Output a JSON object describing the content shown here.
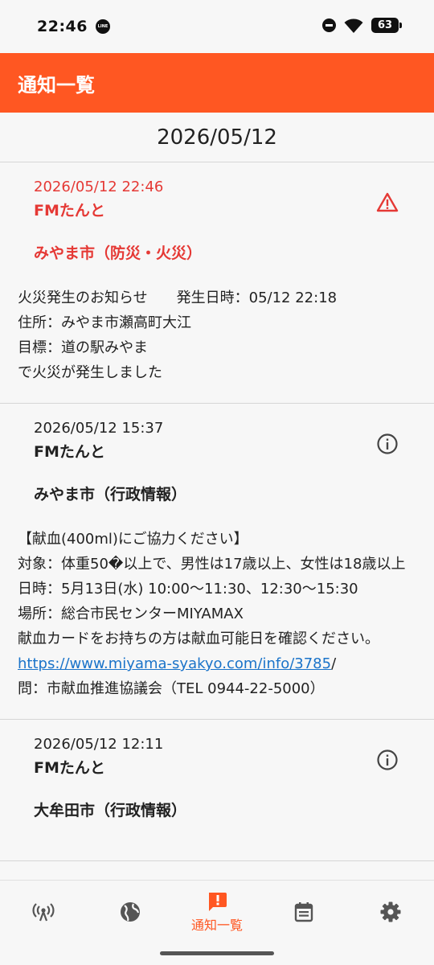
{
  "status_bar": {
    "time": "22:46",
    "line_badge": "LINE",
    "battery": "63"
  },
  "app_bar": {
    "title": "通知一覧"
  },
  "date_header": "2026/05/12",
  "notifications": [
    {
      "type": "alert",
      "icon": "warning-icon",
      "time": "2026/05/12 22:46",
      "source": "FMたんと",
      "category": "みやま市（防災・火災）",
      "body": "火災発生のお知らせ　　発生日時：05/12 22:18\n住所：みやま市瀬高町大江\n目標：道の駅みやま\nで火災が発生しました"
    },
    {
      "type": "info",
      "icon": "info-icon",
      "time": "2026/05/12 15:37",
      "source": "FMたんと",
      "category": "みやま市（行政情報）",
      "body": "【献血(400ml)にご協力ください】\n対象：体重50�以上で、男性は17歳以上、女性は18歳以上\n日時：5月13日(水) 10:00～11:30、12:30～15:30\n場所：総合市民センターMIYAMAX\n献血カードをお持ちの方は献血可能日を確認ください。\n",
      "link": "https://www.miyama-syakyo.com/info/3785",
      "link_suffix": "/",
      "footer": "問：市献血推進協議会（TEL 0944-22-5000）"
    },
    {
      "type": "info",
      "icon": "info-icon",
      "time": "2026/05/12 12:11",
      "source": "FMたんと",
      "category": "大牟田市（行政情報）"
    }
  ],
  "bottom_nav": {
    "items": [
      {
        "icon": "radio-broadcast-icon"
      },
      {
        "icon": "globe-icon"
      },
      {
        "icon": "notification-alert-icon",
        "label": "通知一覧",
        "active": true
      },
      {
        "icon": "calendar-icon"
      },
      {
        "icon": "gear-icon"
      }
    ],
    "active_color": "#ff5722",
    "inactive_color": "#555555"
  },
  "colors": {
    "brand": "#ff5722",
    "alert": "#e53935",
    "link": "#1a73c9"
  }
}
